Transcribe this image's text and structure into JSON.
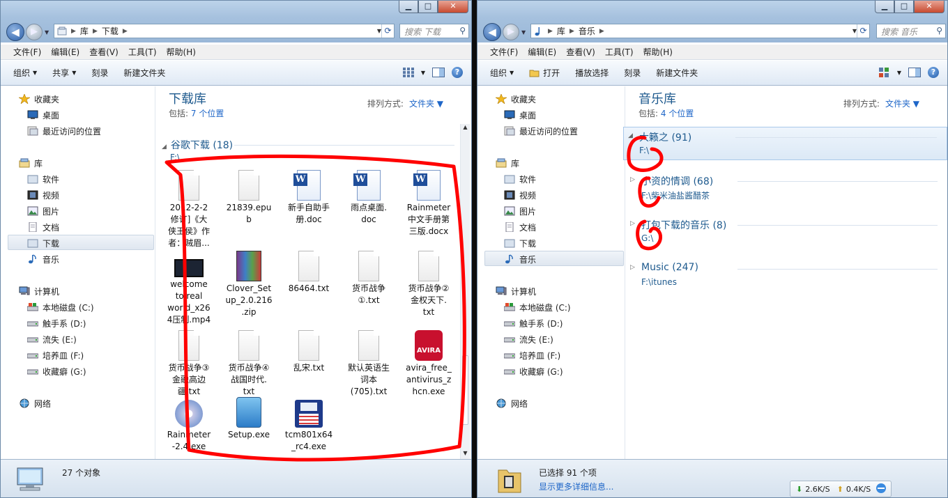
{
  "left": {
    "address": {
      "crumbs": [
        "库",
        "下载"
      ]
    },
    "search_placeholder": "搜索 下载",
    "menu": [
      "文件(F)",
      "编辑(E)",
      "查看(V)",
      "工具(T)",
      "帮助(H)"
    ],
    "commands": [
      {
        "label": "组织",
        "dropdown": true
      },
      {
        "label": "共享",
        "dropdown": true
      },
      {
        "label": "刻录",
        "dropdown": false
      },
      {
        "label": "新建文件夹",
        "dropdown": false
      }
    ],
    "library": {
      "title": "下载库",
      "includes_label": "包括:",
      "includes_link": "7 个位置",
      "sort_label": "排列方式:",
      "sort_value": "文件夹"
    },
    "group": {
      "name": "谷歌下载 (18)",
      "path": "F:\\"
    },
    "files": [
      {
        "name": "2012-2-2\n修订]《大\n侠王侯》作\n者：贼眉...",
        "icon": "blank"
      },
      {
        "name": "21839.epu\nb",
        "icon": "blank"
      },
      {
        "name": "新手自助手\n册.doc",
        "icon": "word"
      },
      {
        "name": "雨点桌面.\ndoc",
        "icon": "word"
      },
      {
        "name": "Rainmeter\n中文手册第\n三版.docx",
        "icon": "word"
      },
      {
        "name": "welcome\nto real\nworld_x26\n4压制.mp4",
        "icon": "video"
      },
      {
        "name": "Clover_Set\nup_2.0.216\n.zip",
        "icon": "zip"
      },
      {
        "name": "86464.txt",
        "icon": "text"
      },
      {
        "name": "货币战争\n①.txt",
        "icon": "text"
      },
      {
        "name": "货币战争②\n金权天下.\ntxt",
        "icon": "text"
      },
      {
        "name": "货币战争③\n金融高边\n疆.txt",
        "icon": "text"
      },
      {
        "name": "货币战争④\n战国时代.\ntxt",
        "icon": "text"
      },
      {
        "name": "乱宋.txt",
        "icon": "text"
      },
      {
        "name": "默认英语生\n词本\n(705).txt",
        "icon": "text"
      },
      {
        "name": "avira_free_\nantivirus_z\nhcn.exe",
        "icon": "avira"
      },
      {
        "name": "Rainmeter\n-2.4.exe",
        "icon": "cd"
      },
      {
        "name": "Setup.exe",
        "icon": "setup"
      },
      {
        "name": "tcm801x64\n_rc4.exe",
        "icon": "floppy"
      }
    ],
    "status": {
      "count": "27 个对象"
    },
    "avira_badge": "AVIRA"
  },
  "right": {
    "address": {
      "crumbs": [
        "库",
        "音乐"
      ]
    },
    "search_placeholder": "搜索 音乐",
    "menu": [
      "文件(F)",
      "编辑(E)",
      "查看(V)",
      "工具(T)",
      "帮助(H)"
    ],
    "commands": [
      {
        "label": "组织",
        "dropdown": true
      },
      {
        "label": "打开",
        "dropdown": false
      },
      {
        "label": "播放选择",
        "dropdown": false
      },
      {
        "label": "刻录",
        "dropdown": false
      },
      {
        "label": "新建文件夹",
        "dropdown": false
      }
    ],
    "library": {
      "title": "音乐库",
      "includes_label": "包括:",
      "includes_link": "4 个位置",
      "sort_label": "排列方式:",
      "sort_value": "文件夹"
    },
    "groups": [
      {
        "name": "大籁之 (91)",
        "path": "F:\\",
        "selected": true
      },
      {
        "name": "小资的情调 (68)",
        "path": "F:\\柴米油盐酱醋茶",
        "selected": false
      },
      {
        "name": "打包下载的音乐 (8)",
        "path": "G:\\",
        "selected": false
      },
      {
        "name": "Music (247)",
        "path": "F:\\itunes",
        "selected": false
      }
    ],
    "status": {
      "line1": "已选择 91 个项",
      "line2": "显示更多详细信息..."
    },
    "net": {
      "down": "2.6K/S",
      "up": "0.4K/S"
    }
  },
  "sidebar": {
    "favorites": "收藏夹",
    "fav_items": [
      "桌面",
      "最近访问的位置"
    ],
    "libraries": "库",
    "lib_items": [
      "软件",
      "视频",
      "图片",
      "文档",
      "下载",
      "音乐"
    ],
    "computer": "计算机",
    "drives": [
      "本地磁盘 (C:)",
      "触手系 (D:)",
      "流失 (E:)",
      "培养皿 (F:)",
      "收藏癖 (G:)"
    ],
    "network": "网络"
  },
  "colors": {
    "accent": "#1e5a8e",
    "link": "#1e66c8",
    "annotation": "#ff0000"
  }
}
